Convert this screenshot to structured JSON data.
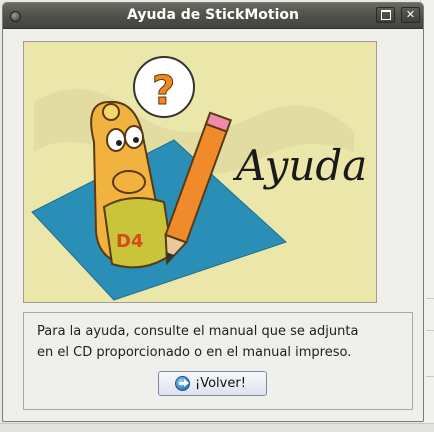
{
  "window": {
    "title": "Ayuda de StickMotion",
    "maximize_glyph": "maximize-icon",
    "close_label": "✕"
  },
  "illustration": {
    "banner_text": "Ayuda",
    "question_mark": "?",
    "shirt_text": "D4",
    "colors": {
      "background": "#ebe6aa",
      "mat": "#2a8fb6",
      "character": "#f2b240",
      "pencil": "#f08a2a",
      "eraser": "#f08aa8"
    }
  },
  "message": {
    "line1": "Para la ayuda, consulte el manual que se adjunta",
    "line2": "en el CD proporcionado o en el manual impreso."
  },
  "buttons": {
    "back_label": "¡Volver!",
    "back_icon": "back-arrow-icon"
  }
}
